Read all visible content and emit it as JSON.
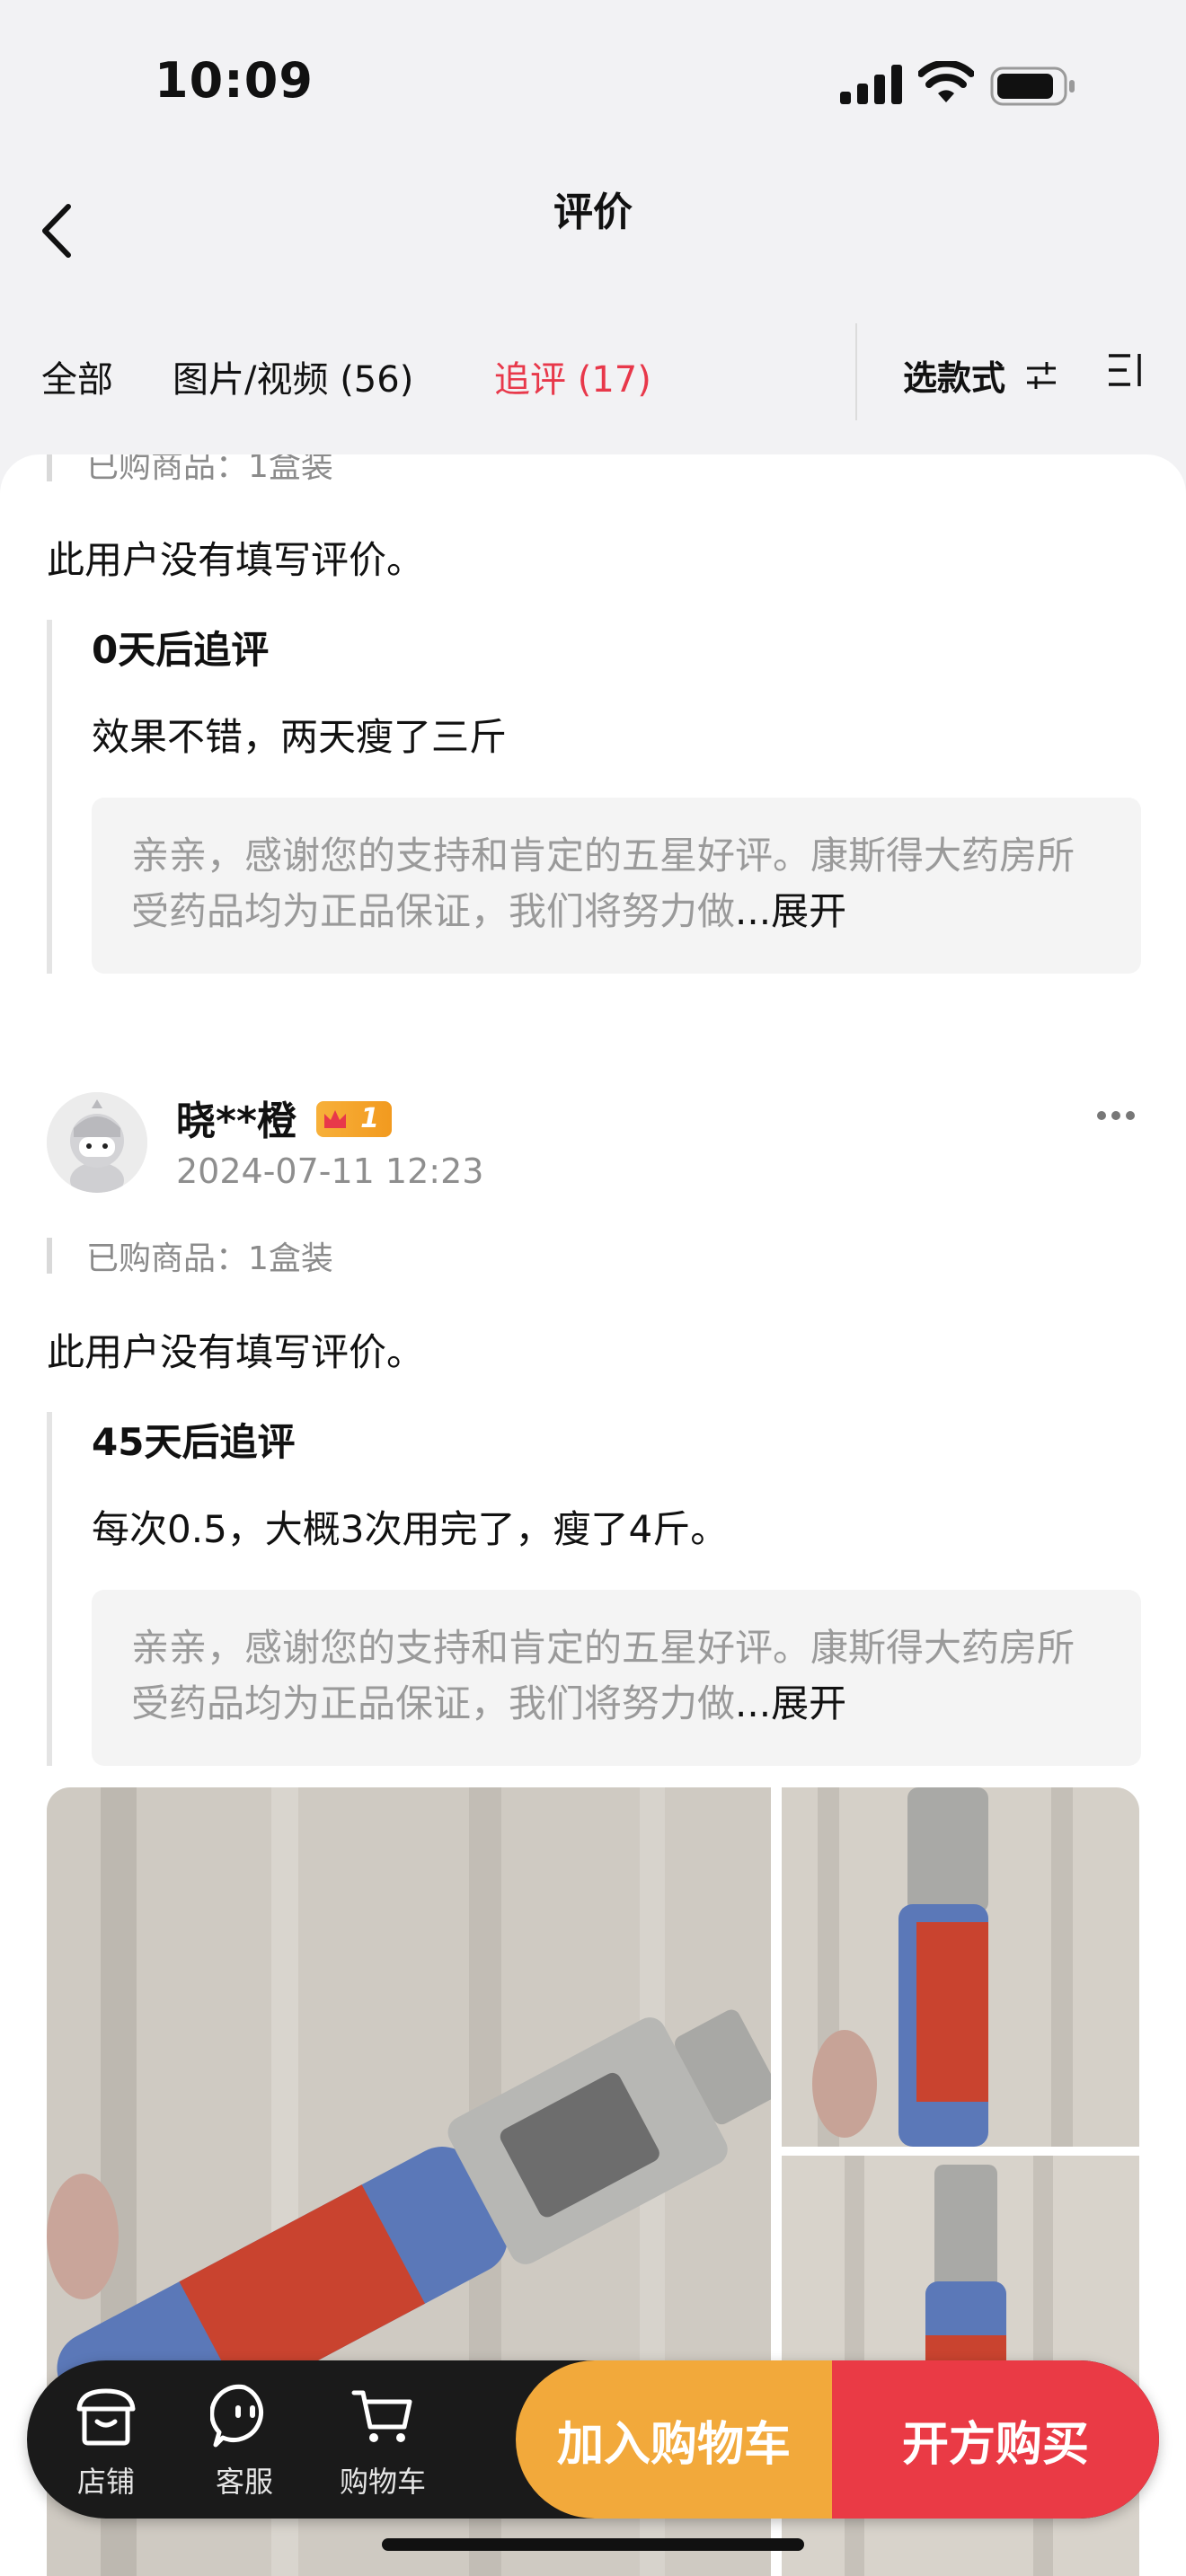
{
  "status_bar": {
    "time": "10:09"
  },
  "header": {
    "title": "评价"
  },
  "tabs": [
    {
      "label": "全部"
    },
    {
      "label": "图片/视频 (56)"
    },
    {
      "label": "追评 (17)"
    }
  ],
  "filters": {
    "style_select": "选款式"
  },
  "reviews": [
    {
      "purchased": "已购商品：1盒装",
      "text": "此用户没有填写评价。",
      "followup_title": "0天后追评",
      "followup_text": "效果不错，两天瘦了三斤",
      "reply": "亲亲，感谢您的支持和肯定的五星好评。康斯得大药房所受药品均为正品保证，我们将努力做",
      "reply_more": "...展开"
    },
    {
      "username": "晓**橙",
      "badge_level": "1",
      "date": "2024-07-11 12:23",
      "purchased": "已购商品：1盒装",
      "text": "此用户没有填写评价。",
      "followup_title": "45天后追评",
      "followup_text": "每次0.5，大概3次用完了，瘦了4斤。",
      "reply": "亲亲，感谢您的支持和肯定的五星好评。康斯得大药房所受药品均为正品保证，我们将努力做",
      "reply_more": "...展开"
    }
  ],
  "bottom_bar": {
    "store": "店铺",
    "service": "客服",
    "cart": "购物车",
    "add_to_cart": "加入购物车",
    "buy": "开方购买"
  },
  "colors": {
    "accent": "#e8384a",
    "cart_button": "#f2a93b",
    "buy_button": "#ea3a45"
  }
}
